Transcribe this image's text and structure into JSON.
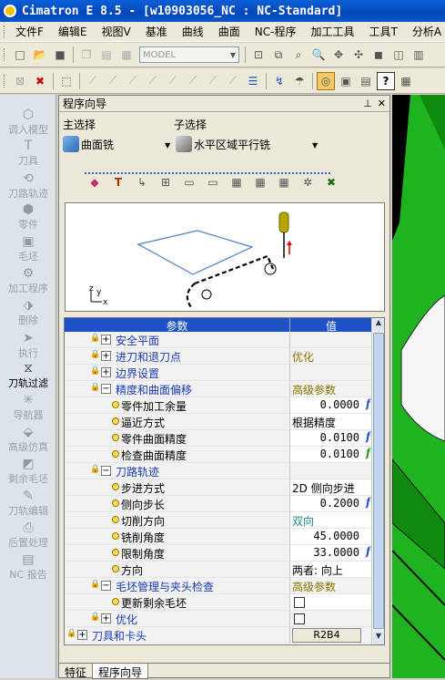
{
  "window": {
    "title": "Cimatron E 8.5 - [w10903056_NC : NC-Standard]"
  },
  "menu": [
    "文件F",
    "编辑E",
    "视图V",
    "基准",
    "曲线",
    "曲面",
    "NC-程序",
    "加工工具",
    "工具T",
    "分析A"
  ],
  "toolbar2": {
    "model_combo": "MODEL"
  },
  "left_panel": {
    "items": [
      "调入模型",
      "刀具",
      "刀路轨迹",
      "零件",
      "毛坯",
      "加工程序",
      "删除",
      "执行",
      "刀轨过滤",
      "导航器",
      "高级仿真",
      "剩余毛坯",
      "刀轨编辑",
      "后置处理",
      "NC 报告"
    ],
    "active_index": 8
  },
  "panel": {
    "title": "程序向导",
    "main_select_label": "主选择",
    "sub_select_label": "子选择",
    "main_select_value": "曲面铣",
    "sub_select_value": "水平区域平行铣",
    "preview_axis_z": "z",
    "preview_axis_y": "y",
    "preview_axis_x": "x"
  },
  "table": {
    "header_param": "参数",
    "header_value": "值",
    "rows": [
      {
        "label": "安全平面",
        "value": ""
      },
      {
        "label": "进刀和退刀点",
        "value": "优化"
      },
      {
        "label": "边界设置",
        "value": ""
      },
      {
        "label": "精度和曲面偏移",
        "value": "高级参数"
      },
      {
        "label": "零件加工余量",
        "value": "0.0000"
      },
      {
        "label": "逼近方式",
        "value": "根据精度"
      },
      {
        "label": "零件曲面精度",
        "value": "0.0100"
      },
      {
        "label": "检查曲面精度",
        "value": "0.0100"
      },
      {
        "label": "刀路轨迹",
        "value": ""
      },
      {
        "label": "步进方式",
        "value": "2D 侧向步进"
      },
      {
        "label": "侧向步长",
        "value": "0.2000"
      },
      {
        "label": "切削方向",
        "value": "双向"
      },
      {
        "label": "铣削角度",
        "value": "45.0000"
      },
      {
        "label": "限制角度",
        "value": "33.0000"
      },
      {
        "label": "方向",
        "value": "两者: 向上"
      },
      {
        "label": "毛坯管理与夹头检查",
        "value": "高级参数"
      },
      {
        "label": "更新剩余毛坯",
        "value": ""
      },
      {
        "label": "优化",
        "value": ""
      },
      {
        "label": "刀具和卡头",
        "value": "R2B4"
      }
    ]
  },
  "tabs": [
    "特征",
    "程序向导"
  ],
  "colors": {
    "title_bar": "#0548b8",
    "table_header": "#1e50c8",
    "advanced_text": "#8b7500",
    "viewport_green": "#1fb31f"
  }
}
